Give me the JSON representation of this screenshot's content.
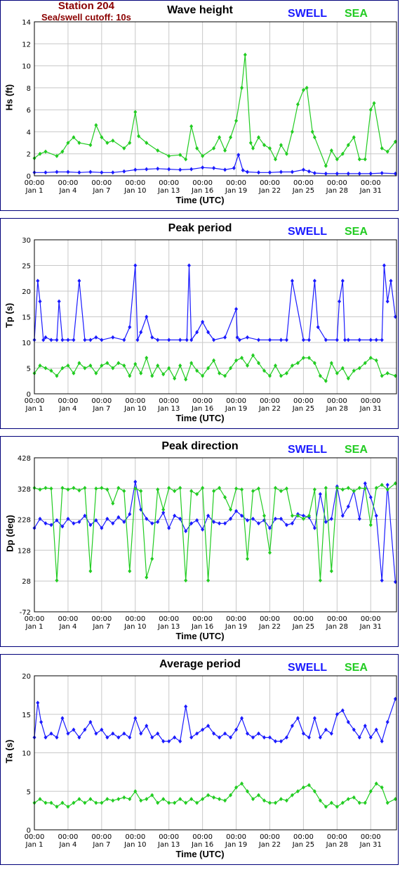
{
  "station": {
    "name": "Station 204",
    "cutoff": "Sea/swell cutoff: 10s"
  },
  "colors": {
    "swell": "#1a1aff",
    "sea": "#22cc22",
    "border": "#00007a",
    "grid": "#c8c8c8",
    "station": "#8b0000"
  },
  "legend": {
    "swell": "SWELL",
    "sea": "SEA"
  },
  "x_axis": {
    "label": "Time (UTC)",
    "ticks": [
      {
        "day": 1,
        "time": "00:00",
        "date": "Jan 1"
      },
      {
        "day": 4,
        "time": "00:00",
        "date": "Jan 4"
      },
      {
        "day": 7,
        "time": "00:00",
        "date": "Jan 7"
      },
      {
        "day": 10,
        "time": "00:00",
        "date": "Jan 10"
      },
      {
        "day": 13,
        "time": "00:00",
        "date": "Jan 13"
      },
      {
        "day": 16,
        "time": "00:00",
        "date": "Jan 16"
      },
      {
        "day": 19,
        "time": "00:00",
        "date": "Jan 19"
      },
      {
        "day": 22,
        "time": "00:00",
        "date": "Jan 22"
      },
      {
        "day": 25,
        "time": "00:00",
        "date": "Jan 25"
      },
      {
        "day": 28,
        "time": "00:00",
        "date": "Jan 28"
      },
      {
        "day": 31,
        "time": "00:00",
        "date": "Jan 31"
      }
    ],
    "range_days": [
      1,
      33.3
    ]
  },
  "chart_data": [
    {
      "type": "line",
      "title": "Wave height",
      "ylabel": "Hs (ft)",
      "ylim": [
        0,
        14
      ],
      "yticks": [
        0,
        2,
        4,
        6,
        8,
        10,
        12,
        14
      ],
      "series": [
        {
          "name": "SWELL",
          "x": [
            1,
            2,
            3,
            4,
            5,
            6,
            7,
            8,
            9,
            10,
            11,
            12,
            13,
            14,
            15,
            16,
            17,
            18,
            18.8,
            19.2,
            19.6,
            20,
            21,
            22,
            23,
            24,
            25,
            25.5,
            26,
            27,
            28,
            29,
            30,
            31,
            32,
            33.2
          ],
          "y": [
            0.3,
            0.3,
            0.35,
            0.35,
            0.3,
            0.35,
            0.3,
            0.3,
            0.4,
            0.55,
            0.6,
            0.65,
            0.6,
            0.55,
            0.6,
            0.75,
            0.7,
            0.55,
            0.7,
            1.9,
            0.5,
            0.35,
            0.3,
            0.3,
            0.35,
            0.35,
            0.55,
            0.4,
            0.25,
            0.2,
            0.2,
            0.2,
            0.2,
            0.2,
            0.25,
            0.2
          ]
        },
        {
          "name": "SEA",
          "x": [
            1,
            1.5,
            2,
            3,
            3.5,
            4,
            4.5,
            5,
            6,
            6.5,
            7,
            7.5,
            8,
            9,
            9.5,
            10,
            10.3,
            11,
            12,
            13,
            14,
            14.5,
            15,
            15.5,
            16,
            17,
            17.5,
            18,
            18.5,
            19,
            19.5,
            19.8,
            20.3,
            20.5,
            21,
            21.5,
            22,
            22.5,
            23,
            23.5,
            24,
            24.5,
            25,
            25.3,
            25.8,
            26,
            27,
            27.5,
            28,
            28.5,
            29,
            29.5,
            30,
            30.5,
            31,
            31.3,
            32,
            32.5,
            33.2
          ],
          "y": [
            1.6,
            2.0,
            2.2,
            1.8,
            2.2,
            3.0,
            3.5,
            3.0,
            2.8,
            4.6,
            3.5,
            3.0,
            3.2,
            2.5,
            3.0,
            5.8,
            3.6,
            3.0,
            2.3,
            1.8,
            1.9,
            1.5,
            4.5,
            2.5,
            1.8,
            2.5,
            3.5,
            2.3,
            3.5,
            5.0,
            8.0,
            11.0,
            3.0,
            2.5,
            3.5,
            2.8,
            2.5,
            1.5,
            2.8,
            2.0,
            4.0,
            6.5,
            7.8,
            8.0,
            4.0,
            3.5,
            0.9,
            2.3,
            1.5,
            2.0,
            2.8,
            3.5,
            1.5,
            1.5,
            6.0,
            6.6,
            2.5,
            2.2,
            3.1
          ]
        }
      ]
    },
    {
      "type": "line",
      "title": "Peak period",
      "ylabel": "Tp (s)",
      "ylim": [
        0,
        30
      ],
      "yticks": [
        0,
        5,
        10,
        15,
        20,
        25,
        30
      ],
      "series": [
        {
          "name": "SWELL",
          "x": [
            1,
            1.3,
            1.5,
            1.8,
            2,
            2.5,
            3,
            3.2,
            3.5,
            4,
            4.5,
            5,
            5.5,
            6,
            6.5,
            7,
            8,
            9,
            9.5,
            10,
            10.2,
            10.5,
            11,
            11.5,
            12,
            13,
            14,
            14.6,
            14.8,
            15,
            15.5,
            16,
            16.5,
            17,
            18,
            19,
            19.1,
            19.3,
            20,
            21,
            22,
            23,
            23.5,
            24,
            25,
            25.5,
            26,
            26.3,
            27,
            28,
            28.2,
            28.5,
            28.7,
            29,
            30,
            31,
            31.5,
            32,
            32.2,
            32.5,
            32.8,
            33.2
          ],
          "y": [
            10.5,
            22,
            18,
            10.5,
            11,
            10.5,
            10.5,
            18,
            10.5,
            10.5,
            10.5,
            22,
            10.5,
            10.5,
            11,
            10.5,
            11,
            10.5,
            13,
            25,
            10.5,
            12,
            15,
            11,
            10.5,
            10.5,
            10.5,
            10.5,
            25,
            10.5,
            12,
            14,
            12,
            10.5,
            11,
            16.5,
            11,
            10.5,
            11,
            10.5,
            10.5,
            10.5,
            10.5,
            22,
            10.5,
            10.5,
            22,
            13,
            10.5,
            10.5,
            18,
            22,
            10.5,
            10.5,
            10.5,
            10.5,
            10.5,
            10.5,
            25,
            18,
            22,
            15
          ]
        },
        {
          "name": "SEA",
          "x": [
            1,
            1.5,
            2,
            2.5,
            3,
            3.5,
            4,
            4.5,
            5,
            5.5,
            6,
            6.5,
            7,
            7.5,
            8,
            8.5,
            9,
            9.5,
            10,
            10.5,
            11,
            11.5,
            12,
            12.5,
            13,
            13.5,
            14,
            14.5,
            15,
            15.5,
            16,
            16.5,
            17,
            17.5,
            18,
            18.5,
            19,
            19.5,
            20,
            20.5,
            21,
            21.5,
            22,
            22.5,
            23,
            23.5,
            24,
            24.5,
            25,
            25.5,
            26,
            26.5,
            27,
            27.5,
            28,
            28.5,
            29,
            29.5,
            30,
            30.5,
            31,
            31.5,
            32,
            32.5,
            33.2
          ],
          "y": [
            4,
            5.5,
            5,
            4.5,
            3.5,
            5,
            5.5,
            4,
            6,
            5,
            5.5,
            4,
            5.5,
            6,
            5,
            6,
            5.5,
            3.5,
            5.8,
            4,
            7,
            3.5,
            5.5,
            3.8,
            5,
            3,
            5.5,
            2.8,
            6,
            4.5,
            3.5,
            5,
            6.5,
            4,
            3.5,
            5,
            6.5,
            7,
            5.5,
            7.5,
            6,
            4.5,
            3.5,
            5.5,
            3.5,
            4,
            5.5,
            6,
            7,
            7,
            6,
            3.5,
            2.5,
            6,
            4,
            5,
            3,
            4.5,
            5,
            6,
            7,
            6.5,
            3.5,
            4,
            3.5
          ]
        }
      ]
    },
    {
      "type": "line",
      "title": "Peak direction",
      "ylabel": "Dp (deg)",
      "ylim": [
        -72,
        428
      ],
      "yticks": [
        -72,
        28,
        128,
        228,
        328,
        428
      ],
      "series": [
        {
          "name": "SWELL",
          "x": [
            1,
            1.5,
            2,
            2.5,
            3,
            3.5,
            4,
            4.5,
            5,
            5.5,
            6,
            6.5,
            7,
            7.5,
            8,
            8.5,
            9,
            9.5,
            10,
            10.5,
            11,
            11.5,
            12,
            12.5,
            13,
            13.5,
            14,
            14.5,
            15,
            15.5,
            16,
            16.5,
            17,
            17.5,
            18,
            18.5,
            19,
            19.5,
            20,
            20.5,
            21,
            21.5,
            22,
            22.5,
            23,
            23.5,
            24,
            24.5,
            25,
            25.5,
            26,
            26.5,
            27,
            27.5,
            28,
            28.5,
            29,
            29.5,
            30,
            30.5,
            31,
            31.5,
            32,
            32.5,
            33.2
          ],
          "y": [
            200,
            230,
            215,
            210,
            225,
            205,
            230,
            215,
            220,
            240,
            210,
            225,
            200,
            230,
            215,
            235,
            220,
            245,
            350,
            260,
            230,
            215,
            220,
            250,
            200,
            240,
            230,
            190,
            215,
            225,
            195,
            240,
            220,
            215,
            215,
            230,
            255,
            240,
            225,
            230,
            215,
            225,
            200,
            230,
            230,
            210,
            215,
            245,
            240,
            235,
            200,
            310,
            220,
            230,
            335,
            240,
            270,
            320,
            230,
            345,
            300,
            240,
            30,
            340,
            25
          ]
        },
        {
          "name": "SEA",
          "x": [
            1,
            1.5,
            2,
            2.5,
            3,
            3.5,
            4,
            4.5,
            5,
            5.5,
            6,
            6.5,
            7,
            7.5,
            8,
            8.5,
            9,
            9.5,
            10,
            10.5,
            11,
            11.5,
            12,
            12.5,
            13,
            13.5,
            14,
            14.5,
            15,
            15.5,
            16,
            16.5,
            17,
            17.5,
            18,
            18.5,
            19,
            19.5,
            20,
            20.5,
            21,
            21.5,
            22,
            22.5,
            23,
            23.5,
            24,
            24.5,
            25,
            25.5,
            26,
            26.5,
            27,
            27.5,
            28,
            28.5,
            29,
            29.5,
            30,
            30.5,
            31,
            31.5,
            32,
            32.5,
            33.2
          ],
          "y": [
            330,
            325,
            330,
            328,
            30,
            330,
            325,
            330,
            322,
            330,
            60,
            328,
            330,
            325,
            280,
            330,
            320,
            60,
            328,
            320,
            40,
            100,
            325,
            260,
            330,
            320,
            330,
            30,
            320,
            310,
            330,
            30,
            320,
            330,
            300,
            260,
            328,
            325,
            100,
            320,
            328,
            240,
            120,
            330,
            320,
            328,
            240,
            240,
            230,
            240,
            325,
            30,
            330,
            60,
            330,
            325,
            330,
            320,
            330,
            328,
            210,
            330,
            340,
            325,
            345
          ]
        }
      ]
    },
    {
      "type": "line",
      "title": "Average period",
      "ylabel": "Ta (s)",
      "ylim": [
        0,
        20
      ],
      "yticks": [
        0,
        5,
        10,
        15,
        20
      ],
      "series": [
        {
          "name": "SWELL",
          "x": [
            1,
            1.3,
            1.6,
            2,
            2.5,
            3,
            3.5,
            4,
            4.5,
            5,
            5.5,
            6,
            6.5,
            7,
            7.5,
            8,
            8.5,
            9,
            9.5,
            10,
            10.5,
            11,
            11.5,
            12,
            12.5,
            13,
            13.5,
            14,
            14.5,
            15,
            15.5,
            16,
            16.5,
            17,
            17.5,
            18,
            18.5,
            19,
            19.5,
            20,
            20.5,
            21,
            21.5,
            22,
            22.5,
            23,
            23.5,
            24,
            24.5,
            25,
            25.5,
            26,
            26.5,
            27,
            27.5,
            28,
            28.5,
            29,
            29.5,
            30,
            30.5,
            31,
            31.5,
            32,
            32.5,
            33.2
          ],
          "y": [
            12,
            16.5,
            14,
            12,
            12.5,
            12,
            14.5,
            12.5,
            13,
            12,
            13,
            14,
            12.5,
            13,
            12,
            12.5,
            12,
            12.5,
            12,
            14.5,
            12.5,
            13.5,
            12,
            12.5,
            11.5,
            11.5,
            12,
            11.5,
            16,
            12,
            12.5,
            13,
            13.5,
            12.5,
            12,
            12.5,
            12,
            13,
            14.5,
            12.5,
            12,
            12.5,
            12,
            12,
            11.5,
            11.5,
            12,
            13.5,
            14.5,
            12.5,
            12,
            14.5,
            12,
            13,
            12.5,
            15,
            15.5,
            14,
            13,
            12,
            13.5,
            12,
            13,
            11.5,
            14,
            17
          ]
        },
        {
          "name": "SEA",
          "x": [
            1,
            1.5,
            2,
            2.5,
            3,
            3.5,
            4,
            4.5,
            5,
            5.5,
            6,
            6.5,
            7,
            7.5,
            8,
            8.5,
            9,
            9.5,
            10,
            10.5,
            11,
            11.5,
            12,
            12.5,
            13,
            13.5,
            14,
            14.5,
            15,
            15.5,
            16,
            16.5,
            17,
            17.5,
            18,
            18.5,
            19,
            19.5,
            20,
            20.5,
            21,
            21.5,
            22,
            22.5,
            23,
            23.5,
            24,
            24.5,
            25,
            25.5,
            26,
            26.5,
            27,
            27.5,
            28,
            28.5,
            29,
            29.5,
            30,
            30.5,
            31,
            31.5,
            32,
            32.5,
            33.2
          ],
          "y": [
            3.5,
            4,
            3.5,
            3.5,
            3,
            3.5,
            3,
            3.5,
            4,
            3.5,
            4,
            3.5,
            3.5,
            4,
            3.8,
            4,
            4.2,
            4,
            5,
            3.8,
            4,
            4.5,
            3.5,
            4,
            3.5,
            3.5,
            4,
            3.5,
            4,
            3.5,
            4,
            4.5,
            4.2,
            4,
            3.8,
            4.5,
            5.5,
            6,
            5,
            4,
            4.5,
            3.8,
            3.5,
            3.5,
            4,
            3.8,
            4.5,
            5,
            5.5,
            5.8,
            5,
            3.8,
            3,
            3.5,
            3,
            3.5,
            4,
            4.2,
            3.5,
            3.5,
            5,
            6,
            5.5,
            3.5,
            4
          ]
        }
      ]
    }
  ]
}
